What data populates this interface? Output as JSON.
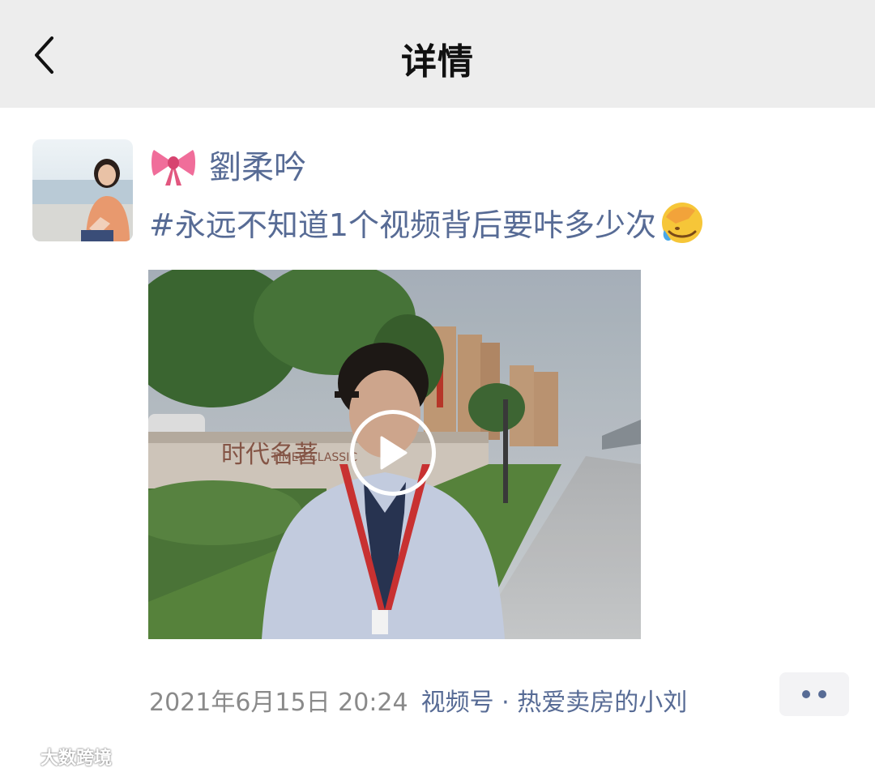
{
  "header": {
    "title": "详情",
    "back_icon": "chevron-left-icon"
  },
  "post": {
    "author": "劉柔吟",
    "author_icon": "ribbon-bow-emoji",
    "text": "#永远不知道1个视频背后要咔多少次",
    "text_icon": "facepalm-emoji",
    "video": {
      "sign_text": "时代名著",
      "sign_subtext": "TIMES CLASSIC",
      "play_icon": "play-icon"
    }
  },
  "footer": {
    "timestamp": "2021年6月15日 20:24",
    "channel": "视频号 · 热爱卖房的小刘",
    "more_icon": "more-dots-icon"
  },
  "watermark": "大数跨境",
  "colors": {
    "link": "#576b95",
    "meta": "#8a8a8a",
    "topbar": "#ededed"
  }
}
